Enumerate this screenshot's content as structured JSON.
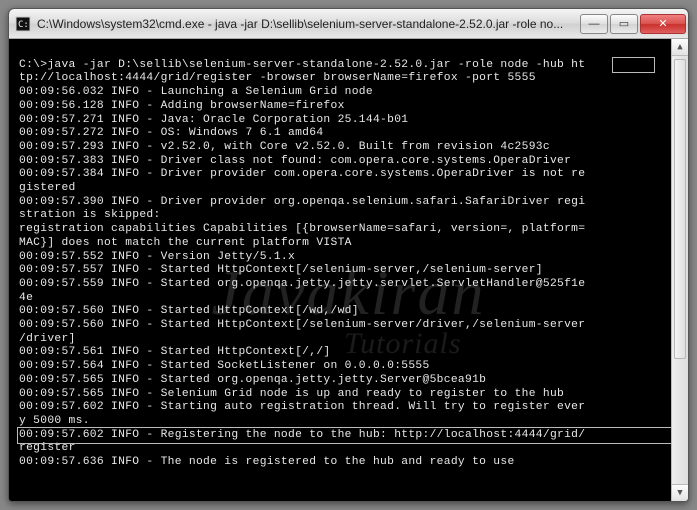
{
  "titlebar": {
    "title": "C:\\Windows\\system32\\cmd.exe - java  -jar D:\\sellib\\selenium-server-standalone-2.52.0.jar -role no..."
  },
  "win_buttons": {
    "min": "—",
    "max": "▭",
    "close": "✕"
  },
  "scrollbar": {
    "up": "▲",
    "down": "▼"
  },
  "watermark": {
    "main": "Javakiran",
    "sub": "Tutorials"
  },
  "console_text": "\nC:\\>java -jar D:\\sellib\\selenium-server-standalone-2.52.0.jar -role node -hub ht\ntp://localhost:4444/grid/register -browser browserName=firefox -port 5555\n00:09:56.032 INFO - Launching a Selenium Grid node\n00:09:56.128 INFO - Adding browserName=firefox\n00:09:57.271 INFO - Java: Oracle Corporation 25.144-b01\n00:09:57.272 INFO - OS: Windows 7 6.1 amd64\n00:09:57.293 INFO - v2.52.0, with Core v2.52.0. Built from revision 4c2593c\n00:09:57.383 INFO - Driver class not found: com.opera.core.systems.OperaDriver\n00:09:57.384 INFO - Driver provider com.opera.core.systems.OperaDriver is not re\ngistered\n00:09:57.390 INFO - Driver provider org.openqa.selenium.safari.SafariDriver regi\nstration is skipped:\nregistration capabilities Capabilities [{browserName=safari, version=, platform=\nMAC}] does not match the current platform VISTA\n00:09:57.552 INFO - Version Jetty/5.1.x\n00:09:57.557 INFO - Started HttpContext[/selenium-server,/selenium-server]\n00:09:57.559 INFO - Started org.openqa.jetty.jetty.servlet.ServletHandler@525f1e\n4e\n00:09:57.560 INFO - Started HttpContext[/wd,/wd]\n00:09:57.560 INFO - Started HttpContext[/selenium-server/driver,/selenium-server\n/driver]\n00:09:57.561 INFO - Started HttpContext[/,/]\n00:09:57.564 INFO - Started SocketListener on 0.0.0.0:5555\n00:09:57.565 INFO - Started org.openqa.jetty.jetty.Server@5bcea91b\n00:09:57.565 INFO - Selenium Grid node is up and ready to register to the hub\n00:09:57.602 INFO - Starting auto registration thread. Will try to register ever\ny 5000 ms.\n00:09:57.602 INFO - Registering the node to the hub: http://localhost:4444/grid/\nregister\n00:09:57.636 INFO - The node is registered to the hub and ready to use\n"
}
